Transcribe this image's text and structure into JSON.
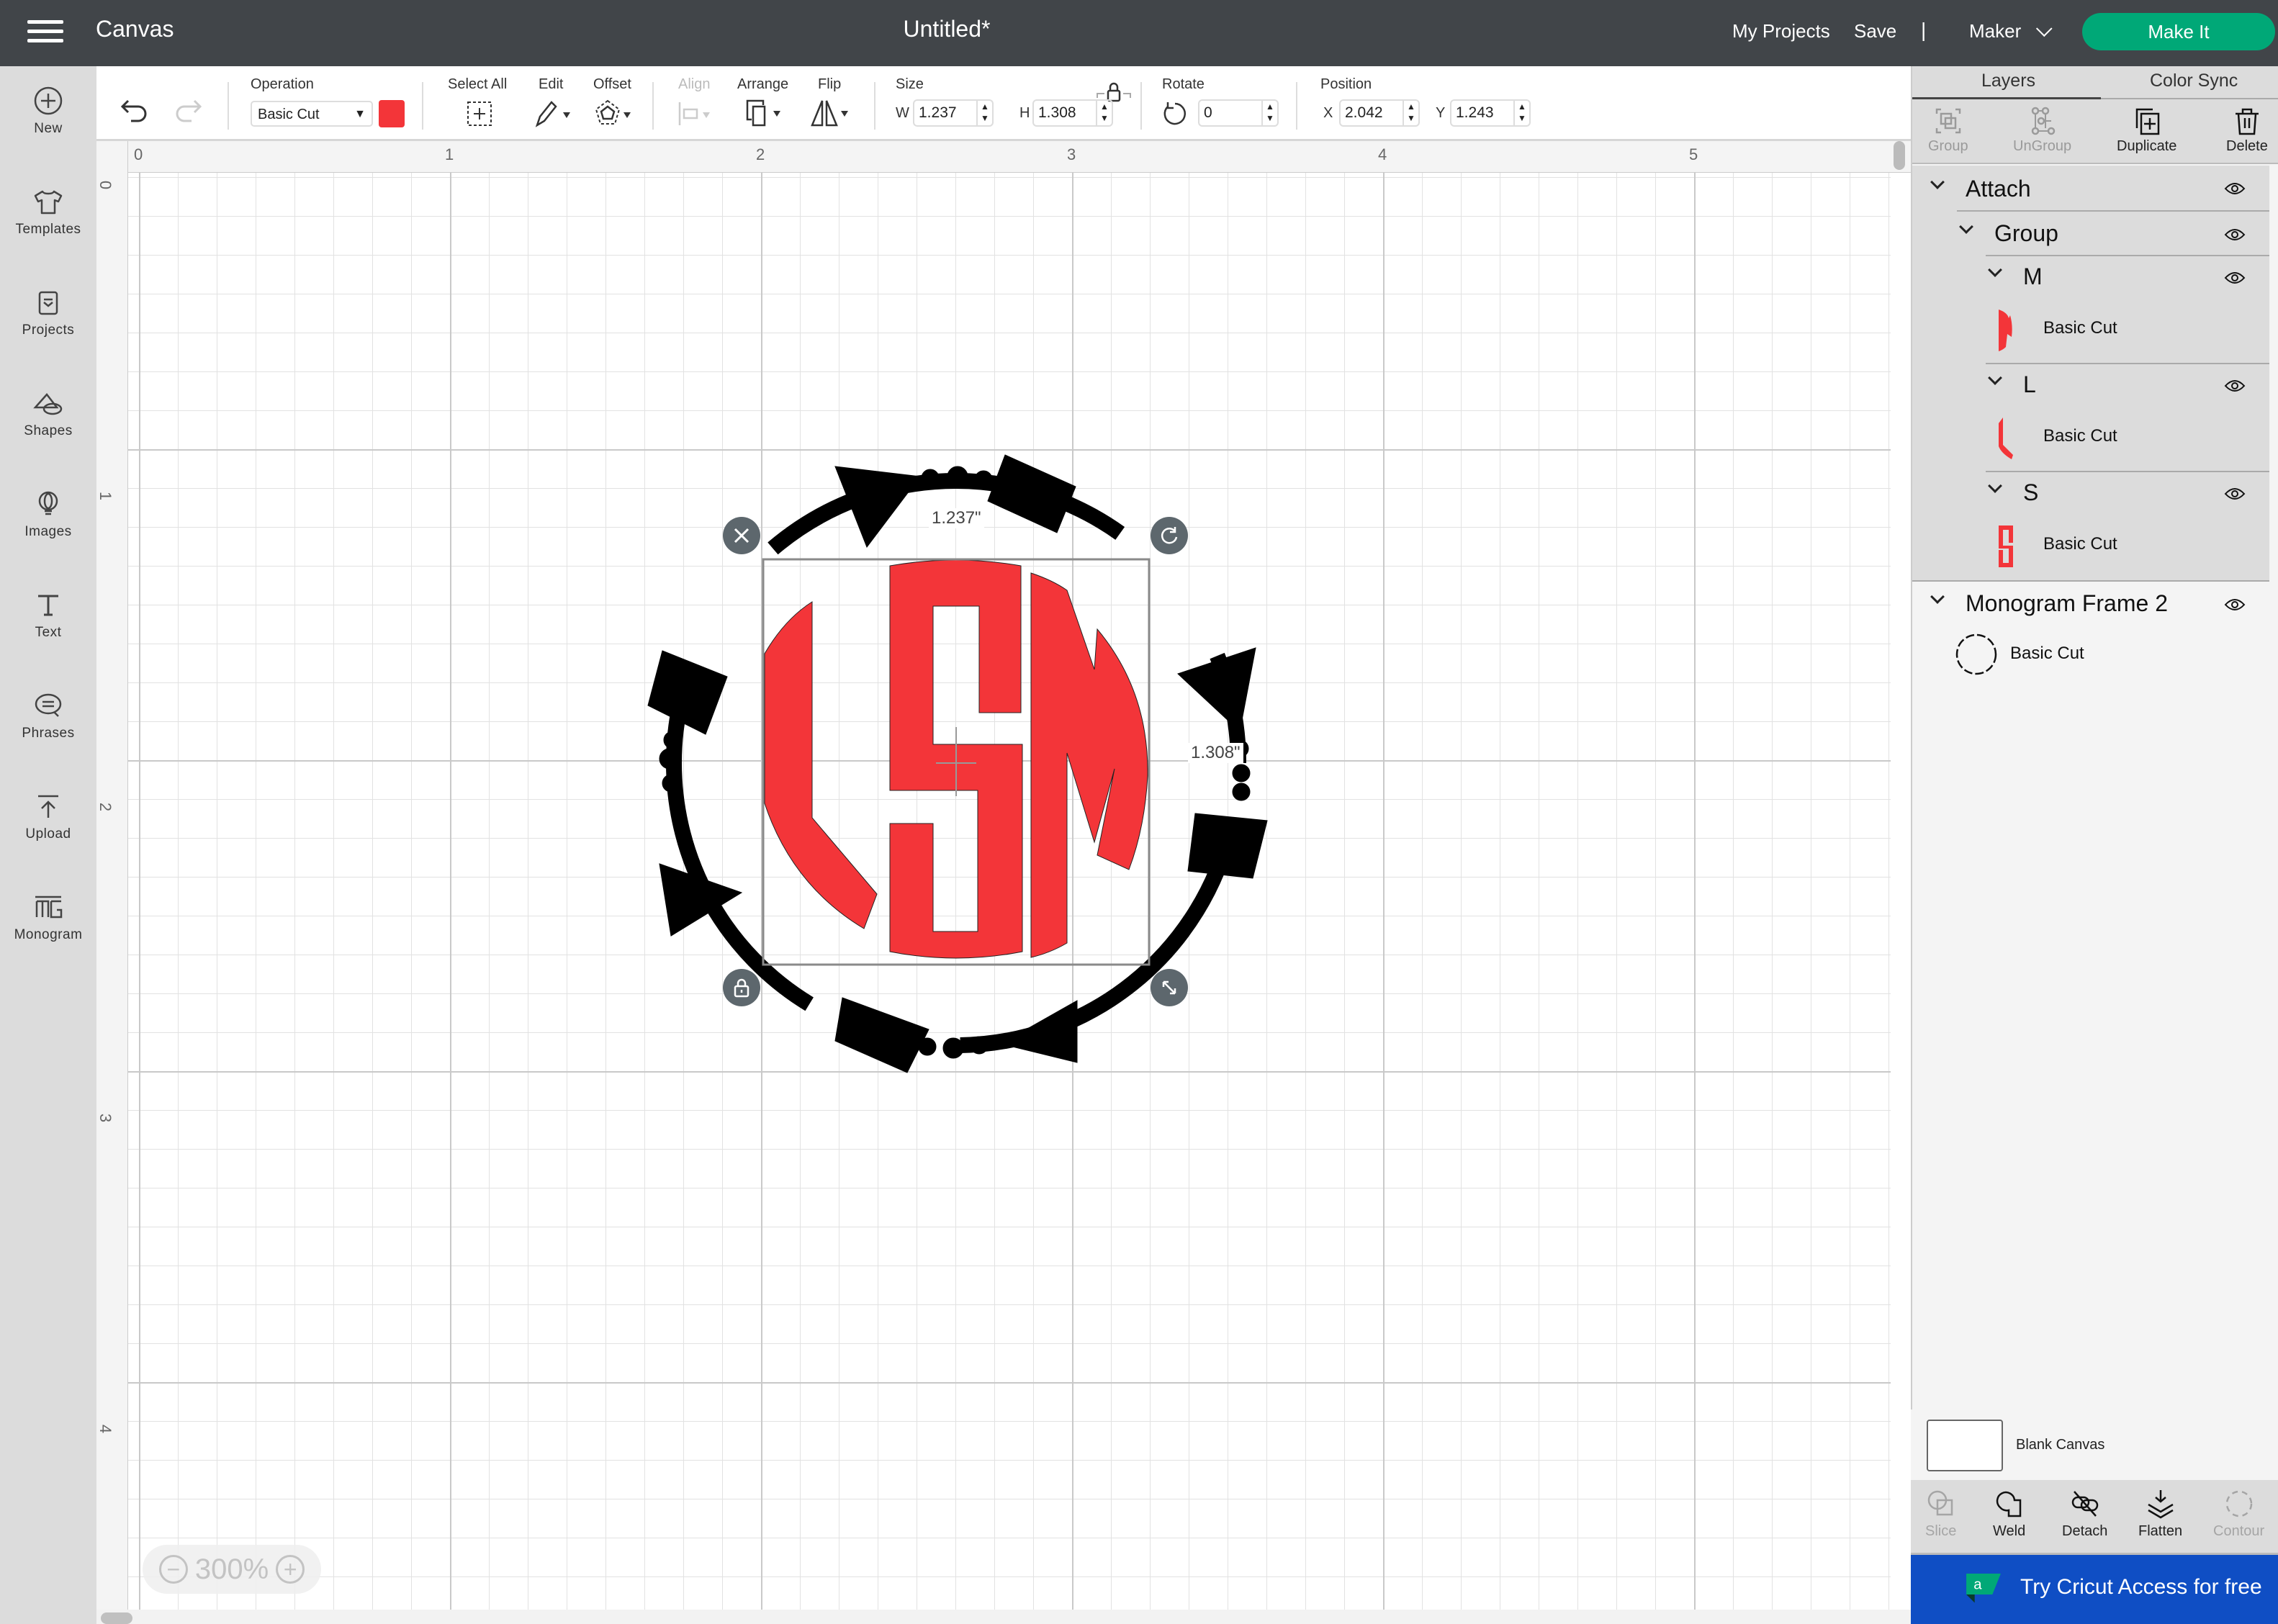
{
  "header": {
    "app_name": "Canvas",
    "doc_title": "Untitled*",
    "my_projects": "My Projects",
    "save": "Save",
    "separator": "|",
    "machine": "Maker",
    "make_it": "Make It"
  },
  "sidebar": {
    "items": [
      {
        "label": "New",
        "icon": "plus-circle-icon"
      },
      {
        "label": "Templates",
        "icon": "tshirt-icon"
      },
      {
        "label": "Projects",
        "icon": "projects-icon"
      },
      {
        "label": "Shapes",
        "icon": "shapes-icon"
      },
      {
        "label": "Images",
        "icon": "lightbulb-icon"
      },
      {
        "label": "Text",
        "icon": "text-icon"
      },
      {
        "label": "Phrases",
        "icon": "speech-bubble-icon"
      },
      {
        "label": "Upload",
        "icon": "upload-icon"
      },
      {
        "label": "Monogram",
        "icon": "monogram-icon"
      }
    ]
  },
  "toolbar": {
    "operation_label": "Operation",
    "operation_value": "Basic Cut",
    "operation_color": "#f33539",
    "select_all_label": "Select All",
    "edit_label": "Edit",
    "offset_label": "Offset",
    "align_label": "Align",
    "arrange_label": "Arrange",
    "flip_label": "Flip",
    "size_label": "Size",
    "width_prefix": "W",
    "width_value": "1.237",
    "height_prefix": "H",
    "height_value": "1.308",
    "rotate_label": "Rotate",
    "rotate_value": "0",
    "position_label": "Position",
    "x_prefix": "X",
    "x_value": "2.042",
    "y_prefix": "Y",
    "y_value": "1.243"
  },
  "rulers": {
    "horizontal": [
      "0",
      "1",
      "2",
      "3",
      "4",
      "5"
    ],
    "vertical": [
      "0",
      "1",
      "2",
      "3",
      "4"
    ]
  },
  "canvas": {
    "zoom_level": "300%",
    "zoom_out": "−",
    "zoom_in": "+",
    "width_dimension": "1.237\"",
    "height_dimension": "1.308\"",
    "monogram_color": "#f33539",
    "frame_color": "#000000"
  },
  "right_panel": {
    "tabs": [
      {
        "label": "Layers",
        "active": true
      },
      {
        "label": "Color Sync",
        "active": false
      }
    ],
    "layer_actions": [
      {
        "label": "Group",
        "enabled": false
      },
      {
        "label": "UnGroup",
        "enabled": false
      },
      {
        "label": "Duplicate",
        "enabled": true
      },
      {
        "label": "Delete",
        "enabled": true
      }
    ],
    "layers": {
      "attach": "Attach",
      "group": "Group",
      "m": {
        "name": "M",
        "operation": "Basic Cut"
      },
      "l": {
        "name": "L",
        "operation": "Basic Cut"
      },
      "s": {
        "name": "S",
        "operation": "Basic Cut"
      },
      "frame": {
        "name": "Monogram Frame 2",
        "operation": "Basic Cut"
      }
    },
    "blank_canvas": "Blank Canvas",
    "bottom_actions": [
      {
        "label": "Slice",
        "enabled": false
      },
      {
        "label": "Weld",
        "enabled": true
      },
      {
        "label": "Detach",
        "enabled": true
      },
      {
        "label": "Flatten",
        "enabled": true
      },
      {
        "label": "Contour",
        "enabled": false
      }
    ],
    "access_banner": "Try Cricut Access for free"
  }
}
